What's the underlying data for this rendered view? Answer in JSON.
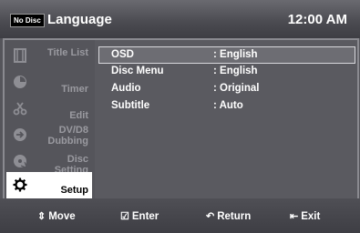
{
  "header": {
    "disc_badge": "No Disc",
    "title": "Language",
    "time": "12:00 AM"
  },
  "sidebar": {
    "items": [
      {
        "label": "Title List",
        "icon": "film-icon"
      },
      {
        "label": "Timer",
        "icon": "timer-icon"
      },
      {
        "label": "Edit",
        "icon": "scissors-icon"
      },
      {
        "label": "DV/D8 Dubbing",
        "label_line1": "DV/D8",
        "label_line2": "Dubbing",
        "icon": "dubbing-icon"
      },
      {
        "label": "Disc Setting",
        "label_line1": "Disc",
        "label_line2": "Setting",
        "icon": "disc-icon"
      },
      {
        "label": "Setup",
        "icon": "gear-icon",
        "active": true
      }
    ]
  },
  "settings": [
    {
      "name": "OSD",
      "value": ": English",
      "selected": true
    },
    {
      "name": "Disc Menu",
      "value": ": English"
    },
    {
      "name": "Audio",
      "value": ": Original"
    },
    {
      "name": "Subtitle",
      "value": ": Auto"
    }
  ],
  "footer": {
    "move": "Move",
    "enter": "Enter",
    "return": "Return",
    "exit": "Exit"
  },
  "colors": {
    "background": "#55555b",
    "active_item": "#ffffff",
    "selection_border": "#d8d8dc"
  }
}
